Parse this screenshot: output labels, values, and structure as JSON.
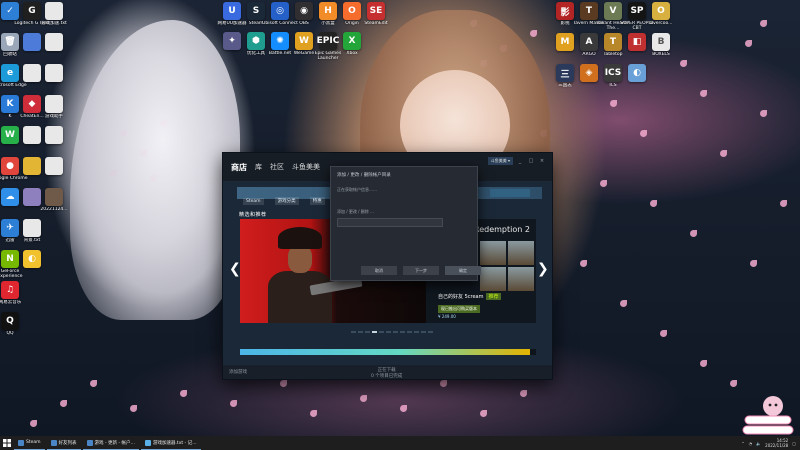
{
  "desktop": {
    "left_icons": [
      {
        "label": "",
        "color": "#2d7fd6",
        "glyph": "✓",
        "icon": "check-app-icon"
      },
      {
        "label": "Logitech G HUB",
        "color": "#1f1f1f",
        "glyph": "G",
        "icon": "logitech-icon"
      },
      {
        "label": "游戏加速.txt",
        "color": "#e8e8e8",
        "glyph": "",
        "icon": "text-file-icon"
      },
      {
        "label": "回收站",
        "color": "#9aa7b8",
        "glyph": "🗑",
        "icon": "recycle-bin-icon"
      },
      {
        "label": "",
        "color": "#4c7bd9",
        "glyph": "",
        "icon": "folder-icon"
      },
      {
        "label": "",
        "color": "#e8e8e8",
        "glyph": "",
        "icon": "file-icon"
      },
      {
        "label": "Microsoft Edge",
        "color": "#1d9bd8",
        "glyph": "e",
        "icon": "edge-icon"
      },
      {
        "label": "",
        "color": "#e8e8e8",
        "glyph": "",
        "icon": "file-icon"
      },
      {
        "label": "",
        "color": "#e8e8e8",
        "glyph": "",
        "icon": "file-icon"
      },
      {
        "label": "K",
        "color": "#2a7ad8",
        "glyph": "K",
        "icon": "k-app-icon"
      },
      {
        "label": "CheatEn...",
        "color": "#d02d3b",
        "glyph": "◆",
        "icon": "cheat-engine-icon"
      },
      {
        "label": "游戏助手",
        "color": "#e8e8e8",
        "glyph": "",
        "icon": "file-icon"
      },
      {
        "label": "",
        "color": "#27b04a",
        "glyph": "W",
        "icon": "wechat-icon"
      },
      {
        "label": "",
        "color": "#e8e8e8",
        "glyph": "",
        "icon": "file-icon"
      },
      {
        "label": "",
        "color": "#e8e8e8",
        "glyph": "",
        "icon": "file-icon"
      },
      {
        "label": "Google Chrome",
        "color": "#e0463b",
        "glyph": "●",
        "icon": "chrome-icon"
      },
      {
        "label": "",
        "color": "#e2b534",
        "glyph": "",
        "icon": "image-icon"
      },
      {
        "label": "",
        "color": "#e8e8e8",
        "glyph": "",
        "icon": "file-icon"
      },
      {
        "label": "",
        "color": "#2e8ee8",
        "glyph": "☁",
        "icon": "cloud-icon"
      },
      {
        "label": "",
        "color": "#8e7fbf",
        "glyph": "",
        "icon": "avatar-file-icon"
      },
      {
        "label": "20221124...",
        "color": "#6f5a4a",
        "glyph": "",
        "icon": "photo-icon"
      },
      {
        "label": "迅雷",
        "color": "#2d7fd6",
        "glyph": "✈",
        "icon": "thunder-icon"
      },
      {
        "label": "背景.txt",
        "color": "#e8e8e8",
        "glyph": "",
        "icon": "text-file-icon"
      },
      {
        "label": "",
        "color": "",
        "glyph": "",
        "icon": "empty"
      },
      {
        "label": "GeForce Experience",
        "color": "#76b900",
        "glyph": "N",
        "icon": "geforce-icon"
      },
      {
        "label": "",
        "color": "#f2c12e",
        "glyph": "◐",
        "icon": "yellow-app-icon"
      },
      {
        "label": "",
        "color": "",
        "glyph": "",
        "icon": "empty"
      },
      {
        "label": "网易云音乐",
        "color": "#e0262f",
        "glyph": "♫",
        "icon": "netease-music-icon"
      },
      {
        "label": "",
        "color": "",
        "glyph": "",
        "icon": "empty"
      },
      {
        "label": "",
        "color": "",
        "glyph": "",
        "icon": "empty"
      },
      {
        "label": "QQ",
        "color": "#111",
        "glyph": "Q",
        "icon": "qq-icon"
      }
    ],
    "top_icons": [
      {
        "label": "网易UU加速器",
        "color": "#3a6ae0",
        "glyph": "U",
        "icon": "uu-icon"
      },
      {
        "label": "Steam",
        "color": "#1b2838",
        "glyph": "S",
        "icon": "steam-icon"
      },
      {
        "label": "Ubisoft Connect",
        "color": "#2460c8",
        "glyph": "◎",
        "icon": "ubisoft-icon"
      },
      {
        "label": "OBS",
        "color": "#302e31",
        "glyph": "◉",
        "icon": "obs-icon"
      },
      {
        "label": "小黑盒",
        "color": "#f28c28",
        "glyph": "H",
        "icon": "heybox-icon"
      },
      {
        "label": "Origin",
        "color": "#f56c2d",
        "glyph": "O",
        "icon": "origin-icon"
      },
      {
        "label": "SteamEdit",
        "color": "#c62f2f",
        "glyph": "SE",
        "icon": "steamedit-icon"
      },
      {
        "label": "",
        "color": "#5a5a8a",
        "glyph": "✦",
        "icon": "app-icon"
      },
      {
        "label": "优化工具",
        "color": "#1f9d8f",
        "glyph": "⬢",
        "icon": "tool-icon"
      },
      {
        "label": "Battle.net",
        "color": "#148eff",
        "glyph": "✺",
        "icon": "battlenet-icon"
      },
      {
        "label": "WeGame",
        "color": "#e0a020",
        "glyph": "W",
        "icon": "wegame-icon"
      },
      {
        "label": "Epic Games Launcher",
        "color": "#222",
        "glyph": "EPIC",
        "icon": "epic-icon"
      },
      {
        "label": "Xbox",
        "color": "#23a53a",
        "glyph": "X",
        "icon": "xbox-icon"
      }
    ],
    "right_icons": [
      {
        "label": "影视",
        "color": "#b32424",
        "glyph": "影",
        "icon": "video-app-icon"
      },
      {
        "label": "Tavern Master",
        "color": "#5a3a20",
        "glyph": "T",
        "icon": "tavern-icon"
      },
      {
        "label": "Valiant Hearts: The...",
        "color": "#6d7b55",
        "glyph": "V",
        "icon": "valiant-icon"
      },
      {
        "label": "SUPER PEOPLE CBT",
        "color": "#141414",
        "glyph": "SP",
        "icon": "super-people-icon"
      },
      {
        "label": "Overcoo...",
        "color": "#d8b040",
        "glyph": "O",
        "icon": "overcooked-icon"
      },
      {
        "label": "",
        "color": "#e0a020",
        "glyph": "M",
        "icon": "m-app-icon"
      },
      {
        "label": "ARGO",
        "color": "#3a3a3a",
        "glyph": "A",
        "icon": "argo-icon"
      },
      {
        "label": "Tabletop",
        "color": "#b8872a",
        "glyph": "T",
        "icon": "tabletop-icon"
      },
      {
        "label": "",
        "color": "#c03030",
        "glyph": "◧",
        "icon": "red-app-icon"
      },
      {
        "label": "BOXELS",
        "color": "#e8e8e8",
        "glyph": "B",
        "icon": "boxels-icon"
      },
      {
        "label": "三国志",
        "color": "#2b3a5a",
        "glyph": "三",
        "icon": "sanguo-icon"
      },
      {
        "label": "",
        "color": "#d0701f",
        "glyph": "◈",
        "icon": "orange-app-icon"
      },
      {
        "label": "ICS",
        "color": "#3a3a3a",
        "glyph": "ICS",
        "icon": "ics-icon"
      },
      {
        "label": "",
        "color": "#6aa0d8",
        "glyph": "◐",
        "icon": "blue-app-icon"
      },
      {
        "label": "",
        "color": "",
        "glyph": "",
        "icon": "empty"
      }
    ]
  },
  "steam": {
    "nav": [
      "商店",
      "库",
      "社区",
      "斗鱼美美"
    ],
    "subnav": [
      "Steam",
      "游戏分类",
      "特惠"
    ],
    "account_button": "斗鱼美美 ▾",
    "window_buttons": [
      "_",
      "□",
      "×"
    ],
    "featured_label": "精选和推荐",
    "side_title": "Redemption 2",
    "game_info": "自己的好友 5cream",
    "badge": "推荐",
    "availability": "现已推出可购买版本",
    "price": "¥ 249.00",
    "bottom_left": "添加游戏",
    "bottom_center": "正在下载",
    "bottom_center_sub": "0 个项目已完成",
    "progress": 0.98,
    "carousel_active": 3,
    "carousel_count": 12
  },
  "dialog": {
    "title": "添加 / 更改 / 删除帐户目录",
    "line1": "正在获取帐户信息……",
    "line2": "添加 / 更改 / 删除 …",
    "input_value": "",
    "cancel": "取消",
    "next": "下一步",
    "confirm": "确定"
  },
  "taskbar": {
    "items": [
      {
        "label": "Steam",
        "icon": "steam-taskbar-icon"
      },
      {
        "label": "好友列表",
        "icon": "friends-taskbar-icon"
      },
      {
        "label": "游戏 - 更新 - 帐户…",
        "icon": "steam-dialog-taskbar-icon"
      },
      {
        "label": "游戏加速器.txt - 记…",
        "icon": "notepad-taskbar-icon"
      }
    ],
    "time": "14:52",
    "date": "2022/11/28"
  }
}
